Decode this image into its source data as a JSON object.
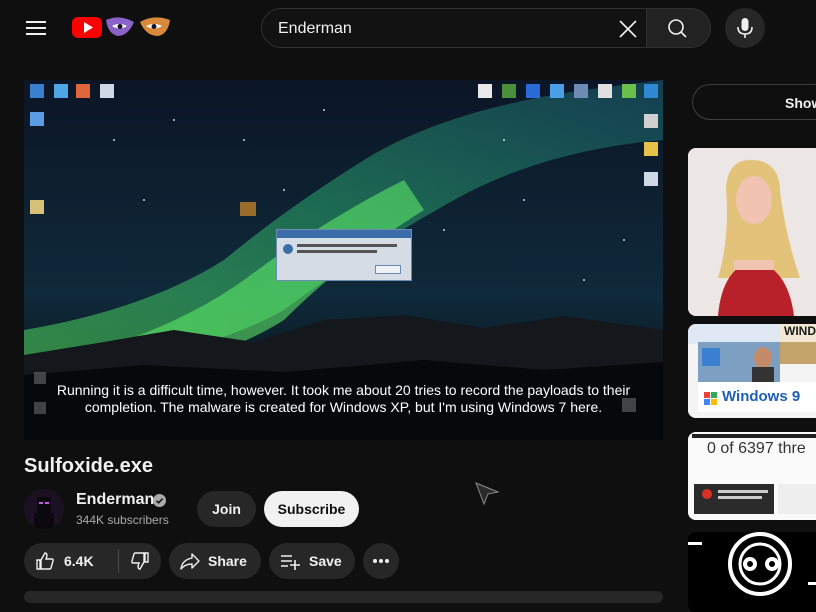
{
  "search": {
    "value": "Enderman"
  },
  "video": {
    "caption": "Running it is a difficult time, however. It took me about 20 tries to record the payloads to their completion. The malware is created for Windows XP, but I'm using Windows 7 here.",
    "title": "Sulfoxide.exe"
  },
  "channel": {
    "name": "Enderman",
    "subscribers": "344K subscribers"
  },
  "buttons": {
    "join": "Join",
    "subscribe": "Subscribe",
    "like_count": "6.4K",
    "share": "Share",
    "save": "Save",
    "show": "Show"
  },
  "sidebar": {
    "thumb3_text": "0 of 6397 thre",
    "thumb2_banner": "WIND",
    "thumb2_windows": "Windows 9"
  },
  "colors": {
    "accent": "#ff0000",
    "aurora": "#4cd26a",
    "bg": "#0f0f0f"
  }
}
